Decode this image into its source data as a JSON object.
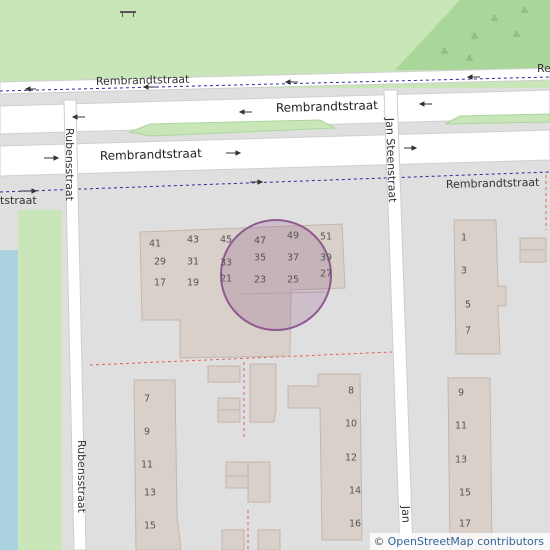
{
  "map": {
    "streets": {
      "rembrandtstraat_top": "Rembrandtstraat",
      "rembrandtstraat_top_right": "Re",
      "rembrandtstraat_mid": "Rembrandtstraat",
      "rembrandtstraat_lower": "Rembrandtstraat",
      "rembrandtstraat_left": "tstraat",
      "rembrandtstraat_right": "Rembrandtstraat",
      "rubensstraat_upper": "Rubensstraat",
      "rubensstraat_lower": "Rubensstraat",
      "jan_steenstraat": "Jan Steenstraat",
      "jan_steenstraat_bottom": "Jan"
    },
    "house_numbers": {
      "n41": "41",
      "n43": "43",
      "n45": "45",
      "n47": "47",
      "n49": "49",
      "n51": "51",
      "n29": "29",
      "n31": "31",
      "n33": "33",
      "n35": "35",
      "n37": "37",
      "n39": "39",
      "n17": "17",
      "n19": "19",
      "n21": "21",
      "n23": "23",
      "n25": "25",
      "n27": "27",
      "e1": "1",
      "e3": "3",
      "e5": "5",
      "e7": "7",
      "s8": "8",
      "s10": "10",
      "s12": "12",
      "s14": "14",
      "s16": "16",
      "w7": "7",
      "w9": "9",
      "w11": "11",
      "w13": "13",
      "w15": "15",
      "r9": "9",
      "r11": "11",
      "r13": "13",
      "r15": "15",
      "r17": "17"
    },
    "colors": {
      "background": "#e0dfdf",
      "park": "#c8e6b8",
      "park_dark": "#a9d79a",
      "water": "#aad3df",
      "road": "#ffffff",
      "road_casing": "#cfcfcf",
      "building": "#d9d0c9",
      "building_stroke": "#c4b6ab",
      "highlight_circle": "#8f5a8f",
      "bus_route": "#2a2a9e",
      "boundary": "#e06060"
    }
  },
  "attribution": {
    "symbol": "©",
    "text": "OpenStreetMap contributors"
  }
}
